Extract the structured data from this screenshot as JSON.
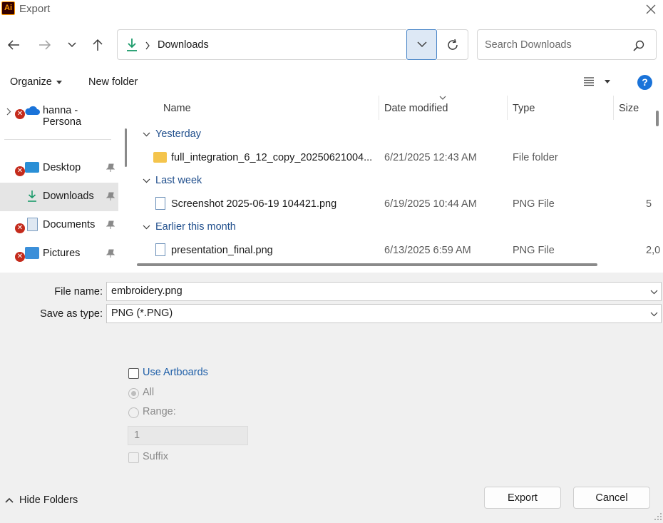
{
  "window": {
    "title": "Export",
    "app_icon_text": "Ai"
  },
  "address": {
    "current": "Downloads"
  },
  "search": {
    "placeholder": "Search Downloads"
  },
  "toolbar": {
    "organize": "Organize",
    "new_folder": "New folder",
    "help": "?"
  },
  "sidebar": {
    "items": [
      {
        "label": "hanna - Persona"
      },
      {
        "label": "Desktop"
      },
      {
        "label": "Downloads"
      },
      {
        "label": "Documents"
      },
      {
        "label": "Pictures"
      }
    ]
  },
  "columns": {
    "name": "Name",
    "date": "Date modified",
    "type": "Type",
    "size": "Size"
  },
  "groups": [
    {
      "header": "Yesterday",
      "rows": [
        {
          "name": "full_integration_6_12_copy_20250621004...",
          "date": "6/21/2025 12:43 AM",
          "type": "File folder",
          "size": ""
        }
      ]
    },
    {
      "header": "Last week",
      "rows": [
        {
          "name": "Screenshot 2025-06-19 104421.png",
          "date": "6/19/2025 10:44 AM",
          "type": "PNG File",
          "size": "5"
        }
      ]
    },
    {
      "header": "Earlier this month",
      "rows": [
        {
          "name": "presentation_final.png",
          "date": "6/13/2025 6:59 AM",
          "type": "PNG File",
          "size": "2,0"
        }
      ]
    }
  ],
  "form": {
    "file_name_label": "File name:",
    "file_name_value": "embroidery.png",
    "save_type_label": "Save as type:",
    "save_type_value": "PNG (*.PNG)",
    "use_artboards": "Use Artboards",
    "all": "All",
    "range": "Range:",
    "range_value": "1",
    "suffix": "Suffix"
  },
  "footer": {
    "hide_folders": "Hide Folders",
    "export": "Export",
    "cancel": "Cancel"
  },
  "colors": {
    "accent": "#1a73d9",
    "link": "#1f4e8c",
    "error": "#c42b1c",
    "selected": "#e5e5e5"
  }
}
